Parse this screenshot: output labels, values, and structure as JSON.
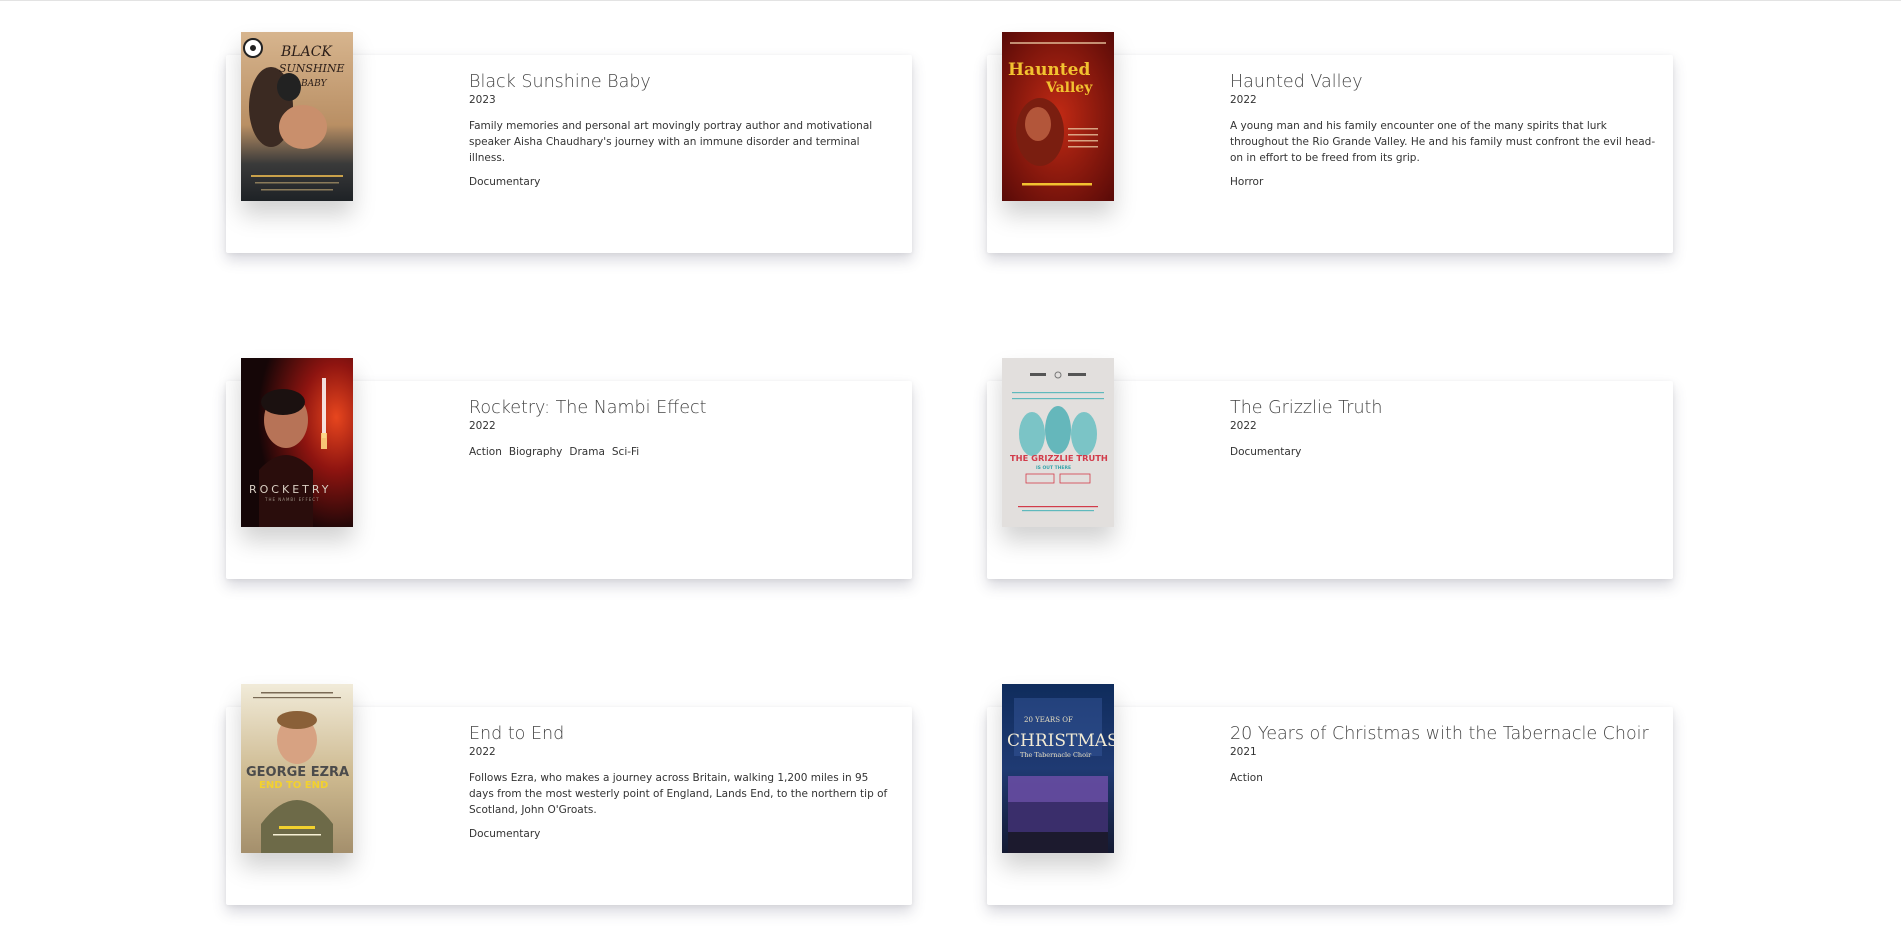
{
  "movies": [
    {
      "title": "Black Sunshine Baby",
      "year": "2023",
      "description": "Family memories and personal art movingly portray author and motivational speaker Aisha Chaudhary's journey with an immune disorder and terminal illness.",
      "genres": [
        "Documentary"
      ],
      "poster": {
        "text_line1": "BLACK",
        "text_line2": "SUNSHINE",
        "text_line3": "BABY"
      }
    },
    {
      "title": "Haunted Valley",
      "year": "2022",
      "description": "A young man and his family encounter one of the many spirits that lurk throughout the Rio Grande Valley. He and his family must confront the evil head-on in effort to be freed from its grip.",
      "genres": [
        "Horror"
      ],
      "poster": {
        "text_line1": "Haunted",
        "text_line2": "Valley"
      }
    },
    {
      "title": "Rocketry: The Nambi Effect",
      "year": "2022",
      "description": "",
      "genres": [
        "Action",
        "Biography",
        "Drama",
        "Sci-Fi"
      ],
      "poster": {
        "text_line1": "ROCKETRY",
        "text_line2": "THE NAMBI EFFECT"
      }
    },
    {
      "title": "The Grizzlie Truth",
      "year": "2022",
      "description": "",
      "genres": [
        "Documentary"
      ],
      "poster": {
        "text_line1": "THE GRIZZLIE TRUTH",
        "text_line2": "IS OUT THERE"
      }
    },
    {
      "title": "End to End",
      "year": "2022",
      "description": "Follows Ezra, who makes a journey across Britain, walking 1,200 miles in 95 days from the most westerly point of England, Lands End, to the northern tip of Scotland, John O'Groats.",
      "genres": [
        "Documentary"
      ],
      "poster": {
        "text_line1": "GEORGE EZRA",
        "text_line2": "END TO END"
      }
    },
    {
      "title": "20 Years of Christmas with the Tabernacle Choir",
      "year": "2021",
      "description": "",
      "genres": [
        "Action"
      ],
      "poster": {
        "text_line1": "20 YEARS OF",
        "text_line2": "CHRISTMAS",
        "text_line3": "The Tabernacle Choir"
      }
    }
  ]
}
